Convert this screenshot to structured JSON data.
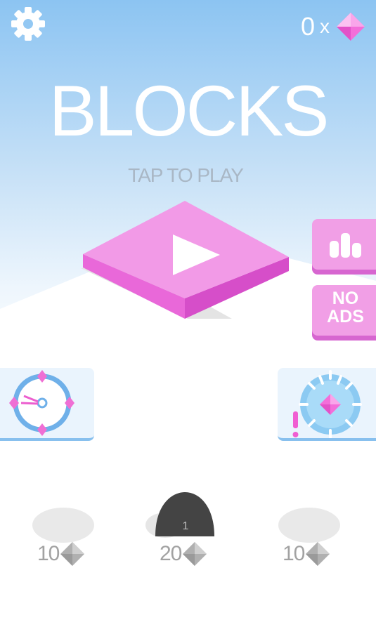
{
  "header": {
    "gem_count": "0",
    "gem_times": "x"
  },
  "title": "BLOCKS",
  "tap_label": "TAP TO PLAY",
  "side_buttons": {
    "noads_label": "NO\nADS"
  },
  "shop": {
    "items": [
      {
        "price": "10",
        "badge": ""
      },
      {
        "price": "20",
        "badge": "1",
        "selected": true
      },
      {
        "price": "10",
        "badge": ""
      }
    ]
  },
  "colors": {
    "sky_top": "#8cc4f2",
    "pink": "#f19fe6",
    "pink_dark": "#d766d0",
    "gem": "#f36ed9",
    "card_blue": "#88c0ee",
    "price_gray": "#a2a2a2"
  },
  "icons": [
    "gear-icon",
    "gem-icon",
    "play-icon",
    "bar-chart-icon",
    "clock-icon",
    "prize-wheel-icon",
    "exclamation-icon",
    "diamond-gray-icon"
  ]
}
